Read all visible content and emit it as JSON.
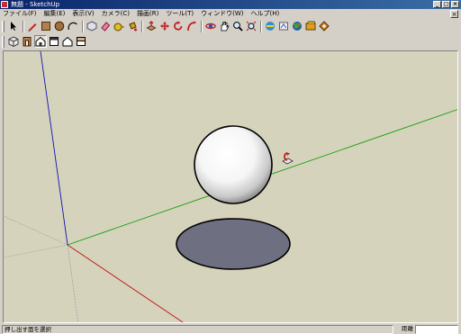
{
  "window": {
    "title": "無題 - SketchUp",
    "buttons": [
      "_",
      "□",
      "×"
    ]
  },
  "menubar": {
    "items": [
      "ファイル(F)",
      "編集(E)",
      "表示(V)",
      "カメラ(C)",
      "描画(R)",
      "ツール(T)",
      "ウィンドウ(W)",
      "ヘルプ(H)"
    ],
    "close_glyph": "×"
  },
  "toolbar_main": {
    "tools": [
      "select-arrow-icon",
      "eraser-icon",
      "pencil-line-icon",
      "rectangle-icon",
      "circle-icon",
      "arc-icon",
      "polygon-icon",
      "paint-bucket-icon",
      "push-pull-icon",
      "follow-me-icon",
      "move-icon",
      "rotate-icon",
      "scale-icon",
      "offset-icon",
      "orbit-icon",
      "pan-icon",
      "zoom-icon",
      "zoom-extents-icon",
      "get-models-icon",
      "share-model-icon",
      "google-earth-icon",
      "component-icon",
      "tape-measure-icon"
    ]
  },
  "toolbar_views": {
    "tools": [
      "iso-view-icon",
      "front-view-icon",
      "top-view-icon",
      "right-view-icon",
      "back-view-icon",
      "left-view-icon"
    ]
  },
  "colors": {
    "viewport_bg": "#d6d3bd",
    "axis_red": "#c01010",
    "axis_green": "#10a010",
    "axis_blue": "#1010b0",
    "sphere_fill": "#ffffff",
    "ellipse_fill": "#6e7082"
  },
  "statusbar": {
    "hint": "押し出す面を選択",
    "measure_label": "距離",
    "measure_value": ""
  }
}
